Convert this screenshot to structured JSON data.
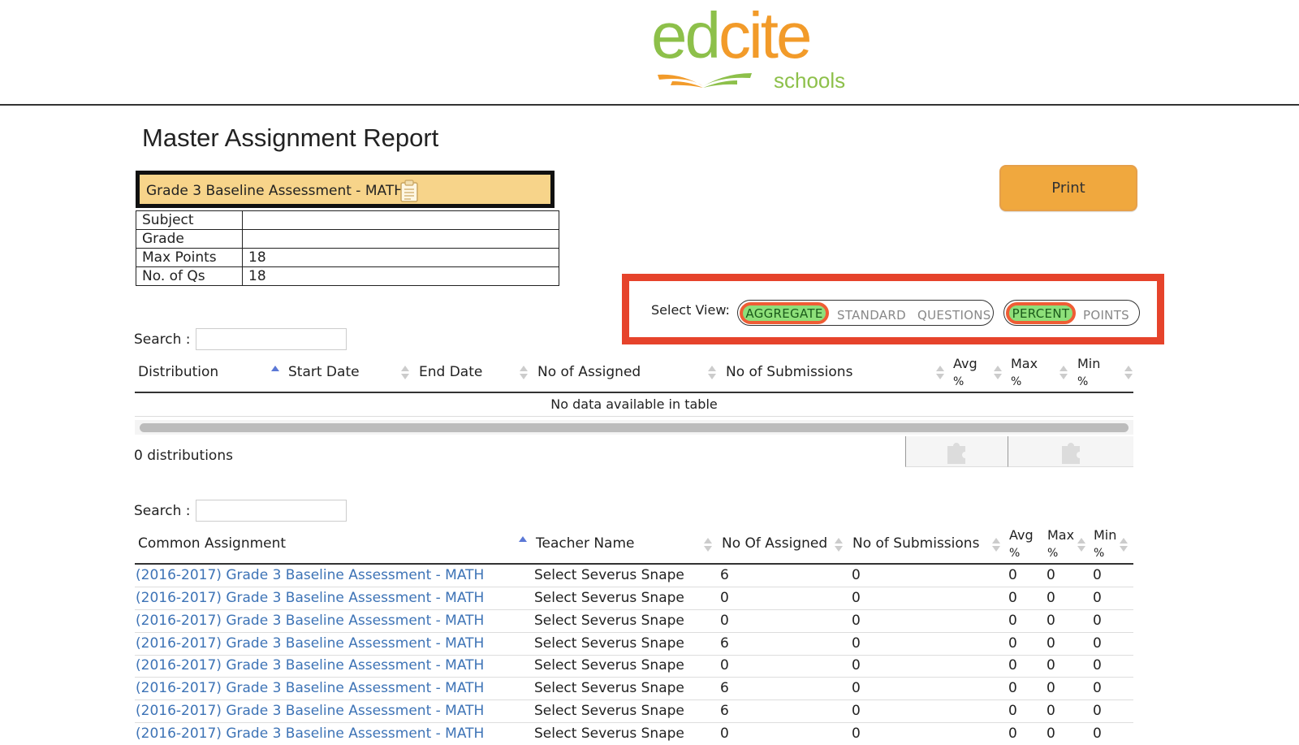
{
  "brand": {
    "logo_part1": "ed",
    "logo_part2": "cite",
    "logo_sub": "schools",
    "green": "#8dc04a",
    "orange": "#f29b2a"
  },
  "page": {
    "title": "Master Assignment Report"
  },
  "assignment": {
    "name": "Grade 3 Baseline Assessment - MATH",
    "icon": "clipboard-icon",
    "fields": [
      {
        "key": "Subject",
        "value": ""
      },
      {
        "key": "Grade",
        "value": ""
      },
      {
        "key": "Max Points",
        "value": "18"
      },
      {
        "key": "No. of Qs",
        "value": "18"
      }
    ]
  },
  "print_label": "Print",
  "select_view": {
    "label": "Select View:",
    "view_options": [
      "AGGREGATE",
      "STANDARD",
      "QUESTIONS"
    ],
    "selected_view": "AGGREGATE",
    "unit_options": [
      "PERCENT",
      "POINTS"
    ],
    "selected_unit": "PERCENT",
    "highlight_color": "#e6432b"
  },
  "distributions": {
    "search_label": "Search :",
    "search_value": "",
    "columns": [
      "Distribution",
      "Start Date",
      "End Date",
      "No of Assigned",
      "No of Submissions",
      "Avg",
      "%",
      "Max",
      "%",
      "Min",
      "%"
    ],
    "empty_message": "No data available in table",
    "count_text": "0 distributions",
    "action_icons": [
      "puzzle-icon",
      "puzzle-icon"
    ]
  },
  "assignments": {
    "search_label": "Search :",
    "search_value": "",
    "columns": [
      "Common Assignment",
      "Teacher Name",
      "No Of Assigned",
      "No of Submissions",
      "Avg",
      "%",
      "Max",
      "%",
      "Min",
      "%"
    ],
    "rows": [
      {
        "name": "(2016-2017) Grade 3 Baseline Assessment - MATH",
        "teacher": "Select Severus Snape",
        "assigned": "6",
        "submissions": "0",
        "avg": "0",
        "max": "0",
        "min": "0"
      },
      {
        "name": "(2016-2017) Grade 3 Baseline Assessment - MATH",
        "teacher": "Select Severus Snape",
        "assigned": "0",
        "submissions": "0",
        "avg": "0",
        "max": "0",
        "min": "0"
      },
      {
        "name": "(2016-2017) Grade 3 Baseline Assessment - MATH",
        "teacher": "Select Severus Snape",
        "assigned": "0",
        "submissions": "0",
        "avg": "0",
        "max": "0",
        "min": "0"
      },
      {
        "name": "(2016-2017) Grade 3 Baseline Assessment - MATH",
        "teacher": "Select Severus Snape",
        "assigned": "6",
        "submissions": "0",
        "avg": "0",
        "max": "0",
        "min": "0"
      },
      {
        "name": "(2016-2017) Grade 3 Baseline Assessment - MATH",
        "teacher": "Select Severus Snape",
        "assigned": "0",
        "submissions": "0",
        "avg": "0",
        "max": "0",
        "min": "0"
      },
      {
        "name": "(2016-2017) Grade 3 Baseline Assessment - MATH",
        "teacher": "Select Severus Snape",
        "assigned": "6",
        "submissions": "0",
        "avg": "0",
        "max": "0",
        "min": "0"
      },
      {
        "name": "(2016-2017) Grade 3 Baseline Assessment - MATH",
        "teacher": "Select Severus Snape",
        "assigned": "6",
        "submissions": "0",
        "avg": "0",
        "max": "0",
        "min": "0"
      },
      {
        "name": "(2016-2017) Grade 3 Baseline Assessment - MATH",
        "teacher": "Select Severus Snape",
        "assigned": "0",
        "submissions": "0",
        "avg": "0",
        "max": "0",
        "min": "0"
      }
    ]
  }
}
